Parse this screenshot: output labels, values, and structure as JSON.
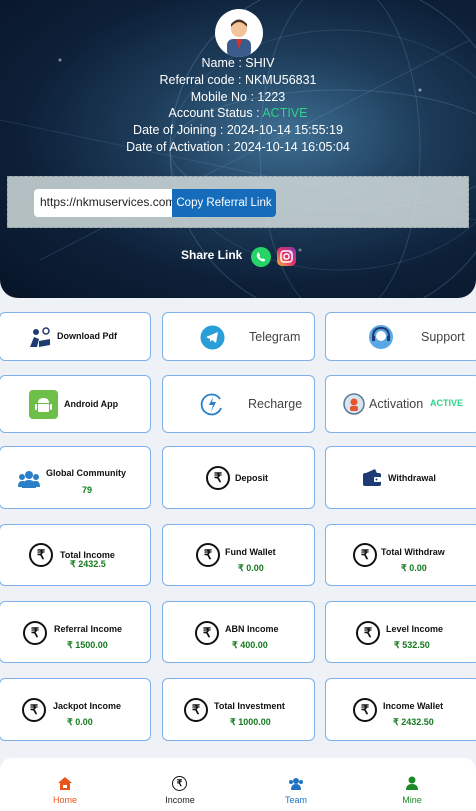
{
  "profile": {
    "name_line": "Name : SHIV",
    "referral_line": "Referral code : NKMU56831",
    "mobile_line": "Mobile No : 1223",
    "status_prefix": "Account Status : ",
    "status_value": "ACTIVE",
    "joining_line": "Date of Joining : 2024-10-14 15:55:19",
    "activation_line": "Date of Activation : 2024-10-14 16:05:04"
  },
  "referral": {
    "link_value": "https://nkmuservices.com",
    "copy_label": "Copy Referral Link"
  },
  "share": {
    "label": "Share Link"
  },
  "quick_links": {
    "download_pdf": "Download Pdf",
    "telegram": "Telegram",
    "support": "Support",
    "android_app": "Android App",
    "recharge": "Recharge",
    "activation": "Activation",
    "activation_status": "ACTIVE",
    "global_community": "Global Community",
    "global_community_count": "79",
    "deposit": "Deposit",
    "withdrawal": "Withdrawal"
  },
  "stats": [
    {
      "label": "Total Income",
      "value": "₹ 2432.5"
    },
    {
      "label": "Fund Wallet",
      "value": "₹ 0.00"
    },
    {
      "label": "Total Withdraw",
      "value": "₹ 0.00"
    },
    {
      "label": "Referral Income",
      "value": "₹ 1500.00"
    },
    {
      "label": "ABN Income",
      "value": "₹ 400.00"
    },
    {
      "label": "Level Income",
      "value": "₹ 532.50"
    },
    {
      "label": "Jackpot Income",
      "value": "₹ 0.00"
    },
    {
      "label": "Total Investment",
      "value": "₹ 1000.00"
    },
    {
      "label": "Income Wallet",
      "value": "₹ 2432.50"
    }
  ],
  "nav": {
    "home": "Home",
    "income": "Income",
    "team": "Team",
    "mine": "Mine"
  },
  "colors": {
    "accent_blue": "#146cba",
    "active_green": "#31d18a",
    "value_green": "#157a1f",
    "card_border": "#7fb0e8",
    "nav_home": "#e8541e",
    "nav_team": "#1f73c2",
    "nav_mine": "#1c8a2b"
  }
}
